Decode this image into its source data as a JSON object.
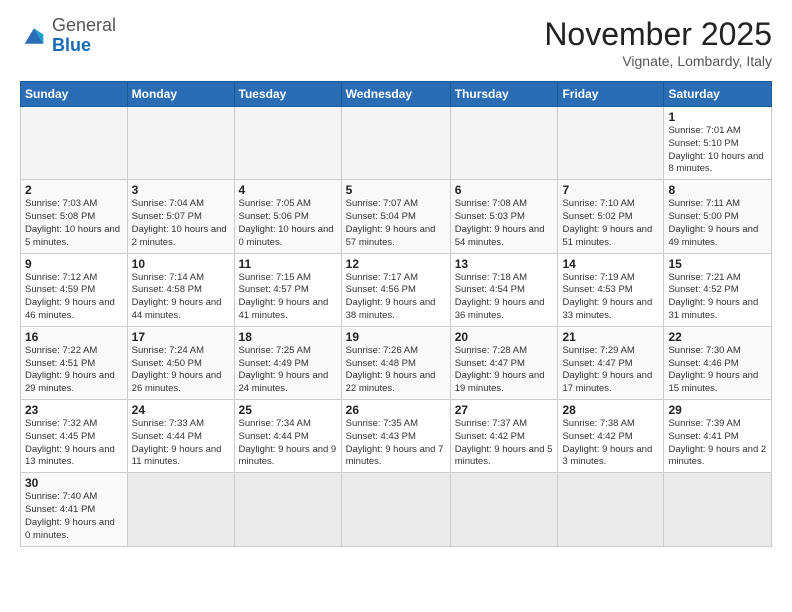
{
  "header": {
    "logo_general": "General",
    "logo_blue": "Blue",
    "month": "November 2025",
    "location": "Vignate, Lombardy, Italy"
  },
  "weekdays": [
    "Sunday",
    "Monday",
    "Tuesday",
    "Wednesday",
    "Thursday",
    "Friday",
    "Saturday"
  ],
  "weeks": [
    [
      {
        "day": "",
        "info": ""
      },
      {
        "day": "",
        "info": ""
      },
      {
        "day": "",
        "info": ""
      },
      {
        "day": "",
        "info": ""
      },
      {
        "day": "",
        "info": ""
      },
      {
        "day": "",
        "info": ""
      },
      {
        "day": "1",
        "info": "Sunrise: 7:01 AM\nSunset: 5:10 PM\nDaylight: 10 hours\nand 8 minutes."
      }
    ],
    [
      {
        "day": "2",
        "info": "Sunrise: 7:03 AM\nSunset: 5:08 PM\nDaylight: 10 hours\nand 5 minutes."
      },
      {
        "day": "3",
        "info": "Sunrise: 7:04 AM\nSunset: 5:07 PM\nDaylight: 10 hours\nand 2 minutes."
      },
      {
        "day": "4",
        "info": "Sunrise: 7:05 AM\nSunset: 5:06 PM\nDaylight: 10 hours\nand 0 minutes."
      },
      {
        "day": "5",
        "info": "Sunrise: 7:07 AM\nSunset: 5:04 PM\nDaylight: 9 hours\nand 57 minutes."
      },
      {
        "day": "6",
        "info": "Sunrise: 7:08 AM\nSunset: 5:03 PM\nDaylight: 9 hours\nand 54 minutes."
      },
      {
        "day": "7",
        "info": "Sunrise: 7:10 AM\nSunset: 5:02 PM\nDaylight: 9 hours\nand 51 minutes."
      },
      {
        "day": "8",
        "info": "Sunrise: 7:11 AM\nSunset: 5:00 PM\nDaylight: 9 hours\nand 49 minutes."
      }
    ],
    [
      {
        "day": "9",
        "info": "Sunrise: 7:12 AM\nSunset: 4:59 PM\nDaylight: 9 hours\nand 46 minutes."
      },
      {
        "day": "10",
        "info": "Sunrise: 7:14 AM\nSunset: 4:58 PM\nDaylight: 9 hours\nand 44 minutes."
      },
      {
        "day": "11",
        "info": "Sunrise: 7:15 AM\nSunset: 4:57 PM\nDaylight: 9 hours\nand 41 minutes."
      },
      {
        "day": "12",
        "info": "Sunrise: 7:17 AM\nSunset: 4:56 PM\nDaylight: 9 hours\nand 38 minutes."
      },
      {
        "day": "13",
        "info": "Sunrise: 7:18 AM\nSunset: 4:54 PM\nDaylight: 9 hours\nand 36 minutes."
      },
      {
        "day": "14",
        "info": "Sunrise: 7:19 AM\nSunset: 4:53 PM\nDaylight: 9 hours\nand 33 minutes."
      },
      {
        "day": "15",
        "info": "Sunrise: 7:21 AM\nSunset: 4:52 PM\nDaylight: 9 hours\nand 31 minutes."
      }
    ],
    [
      {
        "day": "16",
        "info": "Sunrise: 7:22 AM\nSunset: 4:51 PM\nDaylight: 9 hours\nand 29 minutes."
      },
      {
        "day": "17",
        "info": "Sunrise: 7:24 AM\nSunset: 4:50 PM\nDaylight: 9 hours\nand 26 minutes."
      },
      {
        "day": "18",
        "info": "Sunrise: 7:25 AM\nSunset: 4:49 PM\nDaylight: 9 hours\nand 24 minutes."
      },
      {
        "day": "19",
        "info": "Sunrise: 7:26 AM\nSunset: 4:48 PM\nDaylight: 9 hours\nand 22 minutes."
      },
      {
        "day": "20",
        "info": "Sunrise: 7:28 AM\nSunset: 4:47 PM\nDaylight: 9 hours\nand 19 minutes."
      },
      {
        "day": "21",
        "info": "Sunrise: 7:29 AM\nSunset: 4:47 PM\nDaylight: 9 hours\nand 17 minutes."
      },
      {
        "day": "22",
        "info": "Sunrise: 7:30 AM\nSunset: 4:46 PM\nDaylight: 9 hours\nand 15 minutes."
      }
    ],
    [
      {
        "day": "23",
        "info": "Sunrise: 7:32 AM\nSunset: 4:45 PM\nDaylight: 9 hours\nand 13 minutes."
      },
      {
        "day": "24",
        "info": "Sunrise: 7:33 AM\nSunset: 4:44 PM\nDaylight: 9 hours\nand 11 minutes."
      },
      {
        "day": "25",
        "info": "Sunrise: 7:34 AM\nSunset: 4:44 PM\nDaylight: 9 hours\nand 9 minutes."
      },
      {
        "day": "26",
        "info": "Sunrise: 7:35 AM\nSunset: 4:43 PM\nDaylight: 9 hours\nand 7 minutes."
      },
      {
        "day": "27",
        "info": "Sunrise: 7:37 AM\nSunset: 4:42 PM\nDaylight: 9 hours\nand 5 minutes."
      },
      {
        "day": "28",
        "info": "Sunrise: 7:38 AM\nSunset: 4:42 PM\nDaylight: 9 hours\nand 3 minutes."
      },
      {
        "day": "29",
        "info": "Sunrise: 7:39 AM\nSunset: 4:41 PM\nDaylight: 9 hours\nand 2 minutes."
      }
    ],
    [
      {
        "day": "30",
        "info": "Sunrise: 7:40 AM\nSunset: 4:41 PM\nDaylight: 9 hours\nand 0 minutes."
      },
      {
        "day": "",
        "info": ""
      },
      {
        "day": "",
        "info": ""
      },
      {
        "day": "",
        "info": ""
      },
      {
        "day": "",
        "info": ""
      },
      {
        "day": "",
        "info": ""
      },
      {
        "day": "",
        "info": ""
      }
    ]
  ]
}
